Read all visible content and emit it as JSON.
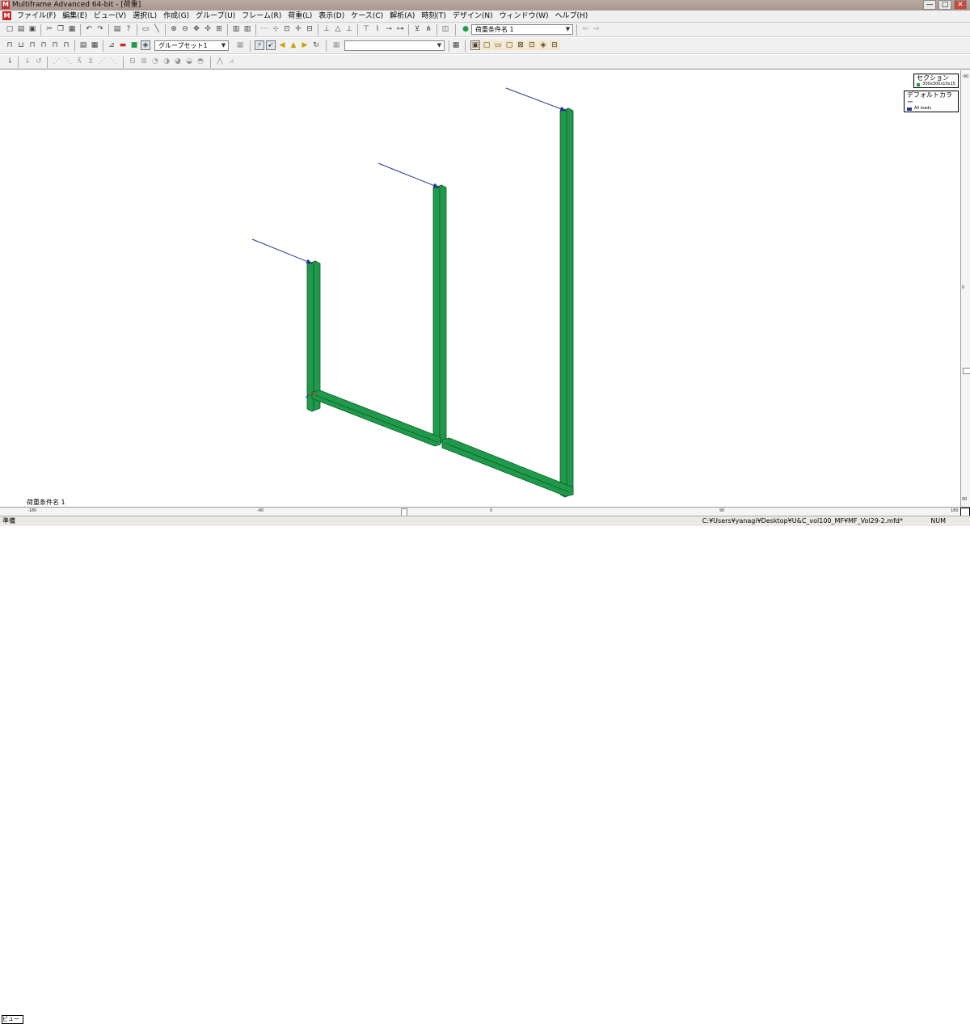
{
  "window": {
    "app_icon": "M",
    "title": "Multiframe Advanced 64-bit - [荷重]",
    "minimize": "—",
    "maximize": "□",
    "close": "✕"
  },
  "menu": [
    "ファイル(F)",
    "編集(E)",
    "ビュー(V)",
    "選択(L)",
    "作成(G)",
    "グループ(U)",
    "フレーム(R)",
    "荷重(L)",
    "表示(D)",
    "ケース(C)",
    "解析(A)",
    "時刻(T)",
    "デザイン(N)",
    "ウィンドウ(W)",
    "ヘルプ(H)"
  ],
  "toolbar": {
    "loadcase_select": "荷重条件名 1",
    "group_select": "グループセット1",
    "empty_select": ""
  },
  "legend": {
    "section_title": "セクション",
    "section_item": "300x300x10x15",
    "section_color": "#1f9a4a",
    "color_title": "デフォルトカラー",
    "color_item": "All loads",
    "color_swatch": "#283593"
  },
  "canvas": {
    "loadcase_label": "荷重条件名 1",
    "view_button": "ビュー",
    "member_color": "#1f9a4a",
    "load_color": "#283593"
  },
  "rulers": {
    "h_labels": [
      "-180",
      "-90",
      "0",
      "90",
      "180"
    ],
    "v_labels": [
      "-90",
      "0",
      "90"
    ]
  },
  "status": {
    "ready": "準備",
    "path": "C:¥Users¥yanagi¥Desktop¥U&C_vol100_MF¥MF_Vol29-2.mfd*",
    "num": "NUM"
  }
}
